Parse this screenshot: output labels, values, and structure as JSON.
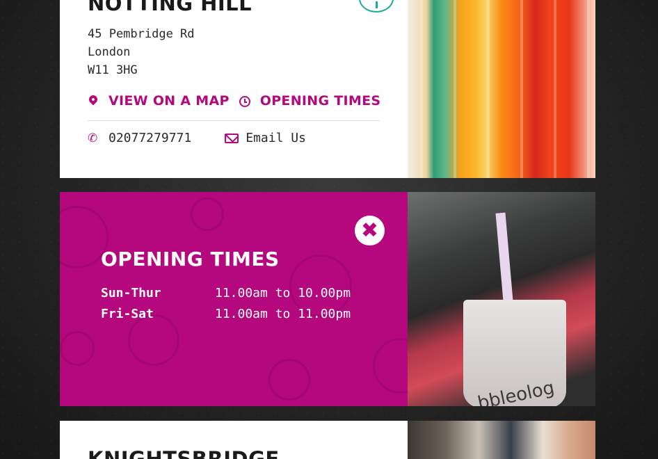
{
  "colors": {
    "brand": "#b5087f",
    "accent_teal": "#1aa89a",
    "card_bg": "#ffffff"
  },
  "store1": {
    "name": "NOTTING HILL",
    "address": [
      "45 Pembridge Rd",
      "London",
      "W11 3HG"
    ],
    "view_map_label": "VIEW ON A MAP",
    "opening_times_label": "OPENING TIMES",
    "phone": "02077279771",
    "email_label": "Email Us"
  },
  "opening_times": {
    "title": "OPENING TIMES",
    "close_icon": "close-icon",
    "rows": [
      {
        "day": "Sun-Thur",
        "time": "11.00am to 10.00pm"
      },
      {
        "day": "Fri-Sat",
        "time": "11.00am to 11.00pm"
      }
    ],
    "cup_text": "bbleolog"
  },
  "store2": {
    "name": "KNIGHTSBRIDGE"
  }
}
